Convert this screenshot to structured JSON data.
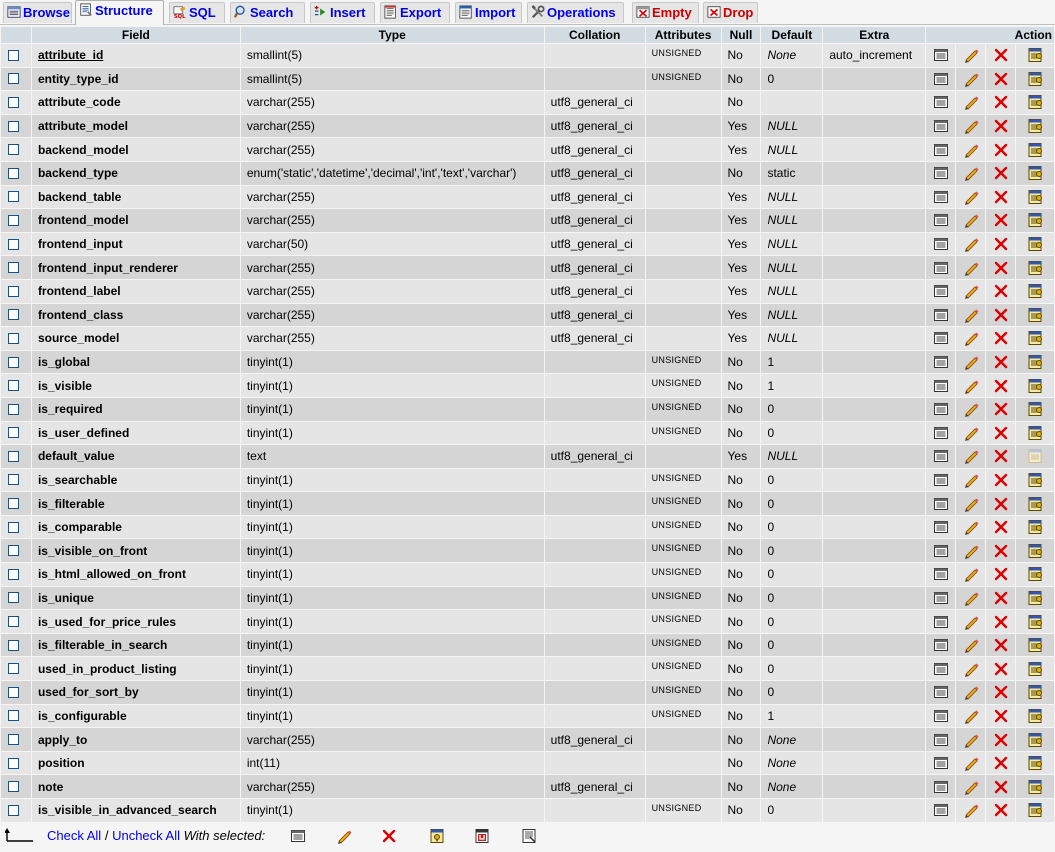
{
  "tabs": [
    {
      "label": "Browse",
      "icon": "browse-icon",
      "state": "normal"
    },
    {
      "label": "Structure",
      "icon": "structure-icon",
      "state": "active"
    },
    {
      "label": "SQL",
      "icon": "sql-icon",
      "state": "normal"
    },
    {
      "label": "Search",
      "icon": "search-icon",
      "state": "normal"
    },
    {
      "label": "Insert",
      "icon": "insert-icon",
      "state": "normal"
    },
    {
      "label": "Export",
      "icon": "export-icon",
      "state": "normal"
    },
    {
      "label": "Import",
      "icon": "import-icon",
      "state": "normal"
    },
    {
      "label": "Operations",
      "icon": "operations-icon",
      "state": "normal"
    },
    {
      "label": "Empty",
      "icon": "empty-icon",
      "state": "danger"
    },
    {
      "label": "Drop",
      "icon": "drop-icon",
      "state": "danger"
    }
  ],
  "columns": {
    "field": "Field",
    "type": "Type",
    "collation": "Collation",
    "attributes": "Attributes",
    "null": "Null",
    "default": "Default",
    "extra": "Extra",
    "action": "Action"
  },
  "rows": [
    {
      "field": "attribute_id",
      "type": "smallint(5)",
      "collation": "",
      "attributes": "UNSIGNED",
      "null": "No",
      "default": "None",
      "default_italic": true,
      "extra": "auto_increment",
      "primary": true
    },
    {
      "field": "entity_type_id",
      "type": "smallint(5)",
      "collation": "",
      "attributes": "UNSIGNED",
      "null": "No",
      "default": "0",
      "default_italic": false,
      "extra": ""
    },
    {
      "field": "attribute_code",
      "type": "varchar(255)",
      "collation": "utf8_general_ci",
      "attributes": "",
      "null": "No",
      "default": "",
      "default_italic": false,
      "extra": ""
    },
    {
      "field": "attribute_model",
      "type": "varchar(255)",
      "collation": "utf8_general_ci",
      "attributes": "",
      "null": "Yes",
      "default": "NULL",
      "default_italic": true,
      "extra": ""
    },
    {
      "field": "backend_model",
      "type": "varchar(255)",
      "collation": "utf8_general_ci",
      "attributes": "",
      "null": "Yes",
      "default": "NULL",
      "default_italic": true,
      "extra": ""
    },
    {
      "field": "backend_type",
      "type": "enum('static','datetime','decimal','int','text','varchar')",
      "collation": "utf8_general_ci",
      "attributes": "",
      "null": "No",
      "default": "static",
      "default_italic": false,
      "extra": ""
    },
    {
      "field": "backend_table",
      "type": "varchar(255)",
      "collation": "utf8_general_ci",
      "attributes": "",
      "null": "Yes",
      "default": "NULL",
      "default_italic": true,
      "extra": ""
    },
    {
      "field": "frontend_model",
      "type": "varchar(255)",
      "collation": "utf8_general_ci",
      "attributes": "",
      "null": "Yes",
      "default": "NULL",
      "default_italic": true,
      "extra": ""
    },
    {
      "field": "frontend_input",
      "type": "varchar(50)",
      "collation": "utf8_general_ci",
      "attributes": "",
      "null": "Yes",
      "default": "NULL",
      "default_italic": true,
      "extra": ""
    },
    {
      "field": "frontend_input_renderer",
      "type": "varchar(255)",
      "collation": "utf8_general_ci",
      "attributes": "",
      "null": "Yes",
      "default": "NULL",
      "default_italic": true,
      "extra": ""
    },
    {
      "field": "frontend_label",
      "type": "varchar(255)",
      "collation": "utf8_general_ci",
      "attributes": "",
      "null": "Yes",
      "default": "NULL",
      "default_italic": true,
      "extra": ""
    },
    {
      "field": "frontend_class",
      "type": "varchar(255)",
      "collation": "utf8_general_ci",
      "attributes": "",
      "null": "Yes",
      "default": "NULL",
      "default_italic": true,
      "extra": ""
    },
    {
      "field": "source_model",
      "type": "varchar(255)",
      "collation": "utf8_general_ci",
      "attributes": "",
      "null": "Yes",
      "default": "NULL",
      "default_italic": true,
      "extra": ""
    },
    {
      "field": "is_global",
      "type": "tinyint(1)",
      "collation": "",
      "attributes": "UNSIGNED",
      "null": "No",
      "default": "1",
      "default_italic": false,
      "extra": ""
    },
    {
      "field": "is_visible",
      "type": "tinyint(1)",
      "collation": "",
      "attributes": "UNSIGNED",
      "null": "No",
      "default": "1",
      "default_italic": false,
      "extra": ""
    },
    {
      "field": "is_required",
      "type": "tinyint(1)",
      "collation": "",
      "attributes": "UNSIGNED",
      "null": "No",
      "default": "0",
      "default_italic": false,
      "extra": ""
    },
    {
      "field": "is_user_defined",
      "type": "tinyint(1)",
      "collation": "",
      "attributes": "UNSIGNED",
      "null": "No",
      "default": "0",
      "default_italic": false,
      "extra": ""
    },
    {
      "field": "default_value",
      "type": "text",
      "collation": "utf8_general_ci",
      "attributes": "",
      "null": "Yes",
      "default": "NULL",
      "default_italic": true,
      "extra": "",
      "index_disabled": true
    },
    {
      "field": "is_searchable",
      "type": "tinyint(1)",
      "collation": "",
      "attributes": "UNSIGNED",
      "null": "No",
      "default": "0",
      "default_italic": false,
      "extra": ""
    },
    {
      "field": "is_filterable",
      "type": "tinyint(1)",
      "collation": "",
      "attributes": "UNSIGNED",
      "null": "No",
      "default": "0",
      "default_italic": false,
      "extra": ""
    },
    {
      "field": "is_comparable",
      "type": "tinyint(1)",
      "collation": "",
      "attributes": "UNSIGNED",
      "null": "No",
      "default": "0",
      "default_italic": false,
      "extra": ""
    },
    {
      "field": "is_visible_on_front",
      "type": "tinyint(1)",
      "collation": "",
      "attributes": "UNSIGNED",
      "null": "No",
      "default": "0",
      "default_italic": false,
      "extra": ""
    },
    {
      "field": "is_html_allowed_on_front",
      "type": "tinyint(1)",
      "collation": "",
      "attributes": "UNSIGNED",
      "null": "No",
      "default": "0",
      "default_italic": false,
      "extra": ""
    },
    {
      "field": "is_unique",
      "type": "tinyint(1)",
      "collation": "",
      "attributes": "UNSIGNED",
      "null": "No",
      "default": "0",
      "default_italic": false,
      "extra": ""
    },
    {
      "field": "is_used_for_price_rules",
      "type": "tinyint(1)",
      "collation": "",
      "attributes": "UNSIGNED",
      "null": "No",
      "default": "0",
      "default_italic": false,
      "extra": ""
    },
    {
      "field": "is_filterable_in_search",
      "type": "tinyint(1)",
      "collation": "",
      "attributes": "UNSIGNED",
      "null": "No",
      "default": "0",
      "default_italic": false,
      "extra": ""
    },
    {
      "field": "used_in_product_listing",
      "type": "tinyint(1)",
      "collation": "",
      "attributes": "UNSIGNED",
      "null": "No",
      "default": "0",
      "default_italic": false,
      "extra": ""
    },
    {
      "field": "used_for_sort_by",
      "type": "tinyint(1)",
      "collation": "",
      "attributes": "UNSIGNED",
      "null": "No",
      "default": "0",
      "default_italic": false,
      "extra": ""
    },
    {
      "field": "is_configurable",
      "type": "tinyint(1)",
      "collation": "",
      "attributes": "UNSIGNED",
      "null": "No",
      "default": "1",
      "default_italic": false,
      "extra": ""
    },
    {
      "field": "apply_to",
      "type": "varchar(255)",
      "collation": "utf8_general_ci",
      "attributes": "",
      "null": "No",
      "default": "None",
      "default_italic": true,
      "extra": ""
    },
    {
      "field": "position",
      "type": "int(11)",
      "collation": "",
      "attributes": "",
      "null": "No",
      "default": "None",
      "default_italic": true,
      "extra": ""
    },
    {
      "field": "note",
      "type": "varchar(255)",
      "collation": "utf8_general_ci",
      "attributes": "",
      "null": "No",
      "default": "None",
      "default_italic": true,
      "extra": ""
    },
    {
      "field": "is_visible_in_advanced_search",
      "type": "tinyint(1)",
      "collation": "",
      "attributes": "UNSIGNED",
      "null": "No",
      "default": "0",
      "default_italic": false,
      "extra": ""
    }
  ],
  "row_actions": [
    "browse-distinct-icon",
    "edit-icon",
    "drop-icon",
    "index-icon"
  ],
  "footer": {
    "check_all": "Check All",
    "separator": "/",
    "uncheck_all": "Uncheck All",
    "with_selected": "With selected:",
    "bulk_actions": [
      "browse-distinct-icon",
      "edit-icon",
      "drop-icon",
      "primary-key-icon",
      "unique-icon",
      "index-icon"
    ]
  },
  "colors": {
    "header_bg": "#d3dce3",
    "row_odd": "#e5e5e5",
    "row_even": "#d5d5d5",
    "link": "#0000ee",
    "danger": "#cc0000"
  }
}
